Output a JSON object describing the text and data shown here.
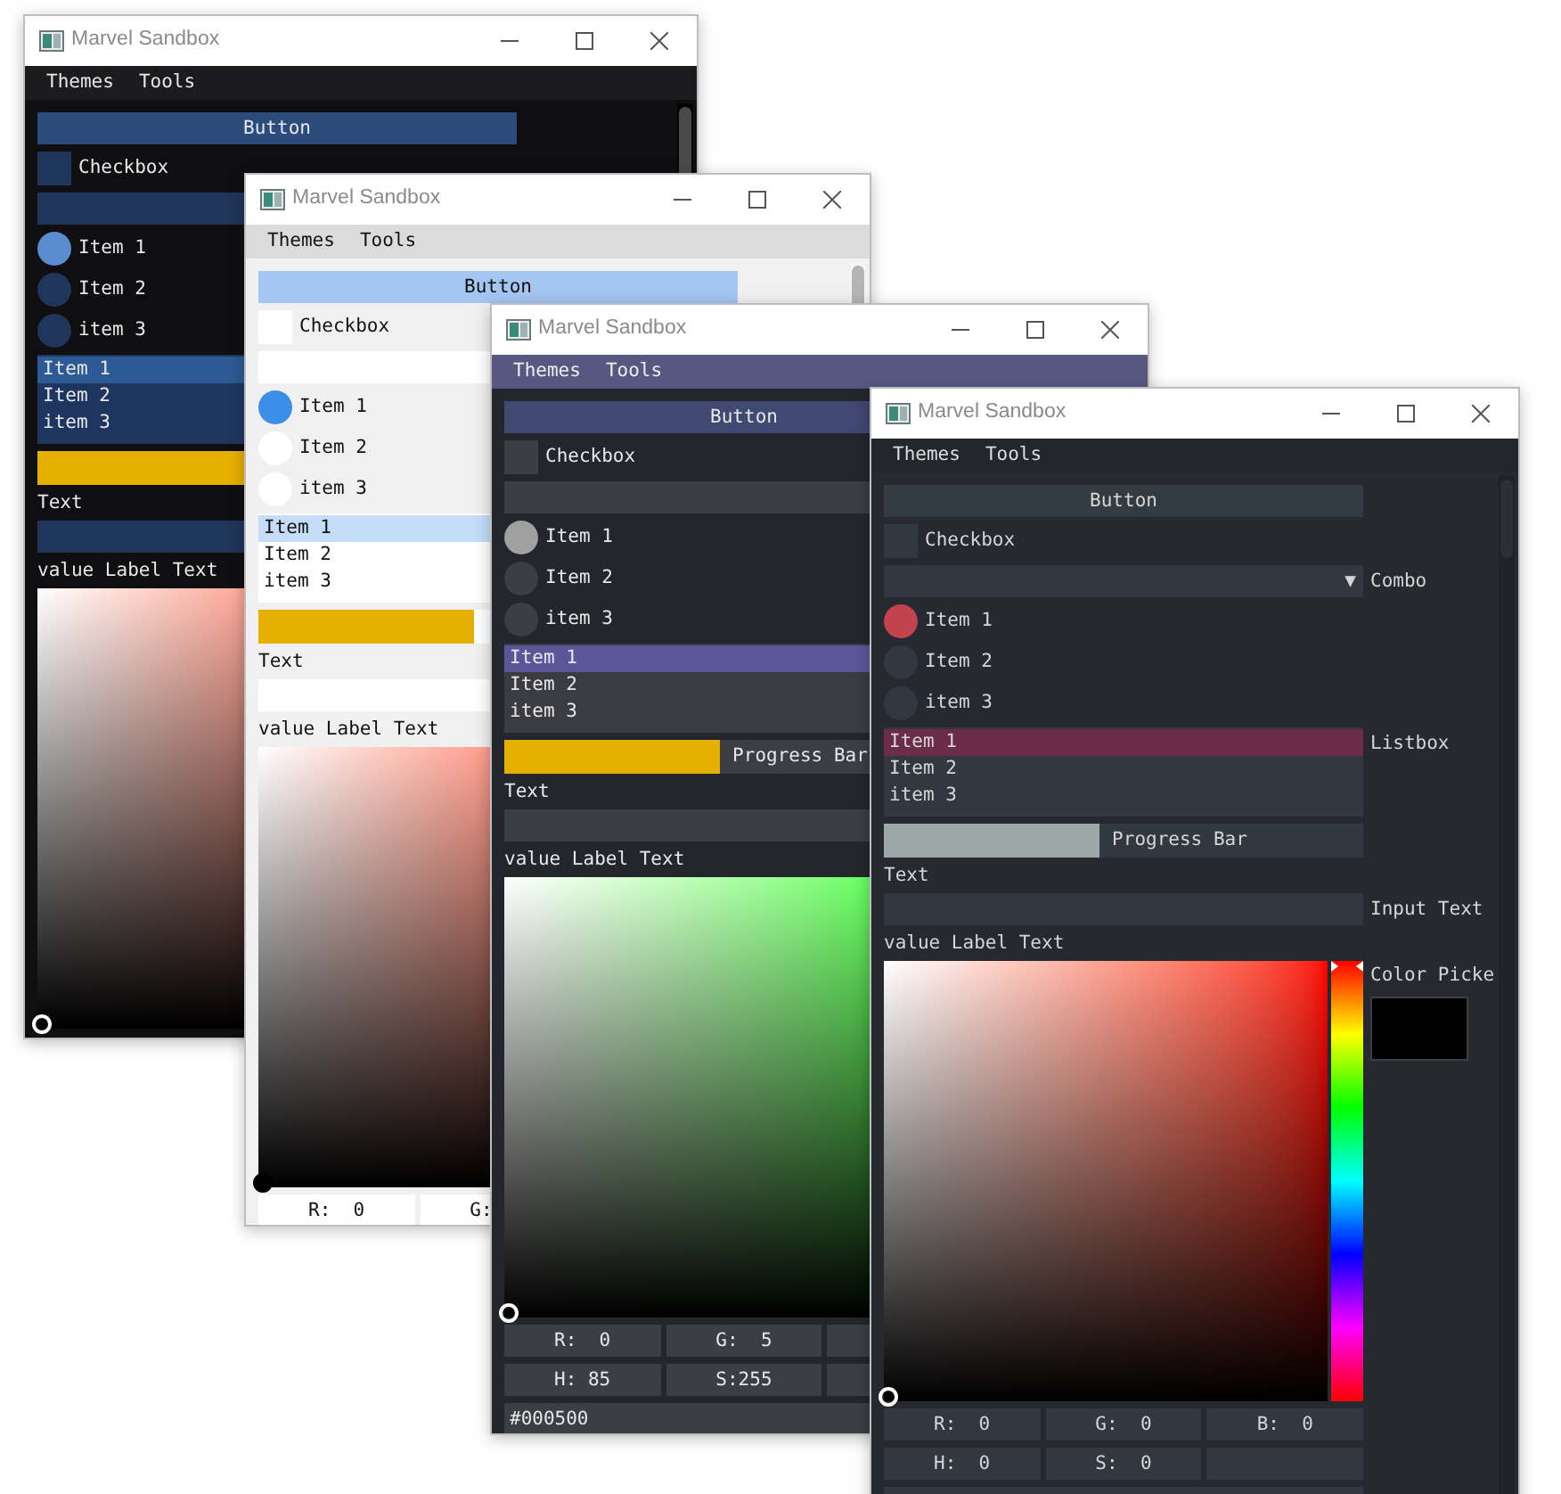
{
  "windows": [
    {
      "title": "Marvel Sandbox",
      "kind": "navy",
      "scrollbar": true,
      "menu": [
        "Themes",
        "Tools"
      ],
      "widgets": [
        {
          "kind": "button",
          "label": "Button"
        },
        {
          "kind": "checkbox",
          "label": "Checkbox",
          "checked": false
        },
        {
          "kind": "combo"
        },
        {
          "kind": "radio",
          "items": [
            {
              "label": "Item 1",
              "selected": true
            },
            {
              "label": "Item 2",
              "selected": false
            },
            {
              "label": "item 3",
              "selected": false
            }
          ]
        },
        {
          "kind": "listbox",
          "items": [
            {
              "label": "Item 1",
              "selected": true
            },
            {
              "label": "Item 2",
              "selected": false
            },
            {
              "label": "item 3",
              "selected": false
            }
          ]
        },
        {
          "kind": "progress",
          "level": 0.45
        },
        {
          "kind": "text",
          "text": "Text"
        },
        {
          "kind": "input"
        },
        {
          "kind": "text",
          "text": "value Label Text"
        },
        {
          "kind": "picker",
          "gradient": {
            "kind": "red"
          }
        }
      ]
    },
    {
      "title": "Marvel Sandbox",
      "kind": "light",
      "scrollbar": true,
      "menu": [
        "Themes",
        "Tools"
      ],
      "widgets": [
        {
          "kind": "button",
          "label": "Button"
        },
        {
          "kind": "checkbox",
          "label": "Checkbox",
          "checked": false
        },
        {
          "kind": "combo"
        },
        {
          "kind": "radio",
          "items": [
            {
              "label": "Item 1",
              "selected": true
            },
            {
              "label": "Item 2",
              "selected": false
            },
            {
              "label": "item 3",
              "selected": false
            }
          ]
        },
        {
          "kind": "listbox",
          "items": [
            {
              "label": "Item 1",
              "selected": true
            },
            {
              "label": "Item 2",
              "selected": false
            },
            {
              "label": "item 3",
              "selected": false
            }
          ]
        },
        {
          "kind": "progress",
          "level": 0.45
        },
        {
          "kind": "text",
          "text": "Text"
        },
        {
          "kind": "input"
        },
        {
          "kind": "text",
          "text": "value Label Text"
        },
        {
          "kind": "picker",
          "gradient": {
            "kind": "red"
          },
          "fields": [
            [
              "R:  0",
              "G:"
            ]
          ]
        }
      ]
    },
    {
      "title": "Marvel Sandbox",
      "kind": "grape",
      "menu": [
        "Themes",
        "Tools"
      ],
      "widgets": [
        {
          "kind": "button",
          "label": "Button"
        },
        {
          "kind": "checkbox",
          "label": "Checkbox",
          "checked": false
        },
        {
          "kind": "combo"
        },
        {
          "kind": "radio",
          "items": [
            {
              "label": "Item 1",
              "selected": true
            },
            {
              "label": "Item 2",
              "selected": false
            },
            {
              "label": "item 3",
              "selected": false
            }
          ]
        },
        {
          "kind": "listbox",
          "items": [
            {
              "label": "Item 1",
              "selected": true
            },
            {
              "label": "Item 2",
              "selected": false
            },
            {
              "label": "item 3",
              "selected": false
            }
          ]
        },
        {
          "kind": "progress",
          "level": 0.45,
          "text": "Progress Bar"
        },
        {
          "kind": "text",
          "text": "Text"
        },
        {
          "kind": "input"
        },
        {
          "kind": "text",
          "text": "value Label Text"
        },
        {
          "kind": "picker",
          "gradient": {
            "kind": "green"
          },
          "fields": [
            [
              "R:  0",
              "G:  5",
              {
                "kind": "blank"
              }
            ],
            [
              "H: 85",
              "S:255",
              {
                "kind": "blank"
              }
            ]
          ],
          "hex": "#000500"
        }
      ]
    },
    {
      "title": "Marvel Sandbox",
      "kind": "slate",
      "scrollbar": true,
      "menu": [
        "Themes",
        "Tools"
      ],
      "widgets": [
        {
          "kind": "button",
          "label": "Button"
        },
        {
          "kind": "checkbox",
          "label": "Checkbox",
          "checked": false
        },
        {
          "kind": "combo",
          "arrow": "▼",
          "label": "Combo"
        },
        {
          "kind": "radio",
          "items": [
            {
              "label": "Item 1",
              "selected": true
            },
            {
              "label": "Item 2",
              "selected": false
            },
            {
              "label": "item 3",
              "selected": false
            }
          ]
        },
        {
          "kind": "listbox",
          "label": "Listbox",
          "items": [
            {
              "label": "Item 1",
              "selected": true
            },
            {
              "label": "Item 2",
              "selected": false
            },
            {
              "label": "item 3",
              "selected": false
            }
          ]
        },
        {
          "kind": "progress",
          "level": 0.45,
          "text": "Progress Bar"
        },
        {
          "kind": "text",
          "text": "Text"
        },
        {
          "kind": "input",
          "label": "Input Text"
        },
        {
          "kind": "text",
          "text": "value Label Text"
        },
        {
          "kind": "picker",
          "gradient": {
            "kind": "red"
          },
          "hue_bar": true,
          "preview": true,
          "label": "Color Picke",
          "fields": [
            [
              "R:  0",
              "G:  0",
              "B:  0"
            ],
            [
              "H:  0",
              "S:  0",
              {
                "kind": "blank"
              }
            ]
          ],
          "hex_field": true
        }
      ]
    }
  ]
}
